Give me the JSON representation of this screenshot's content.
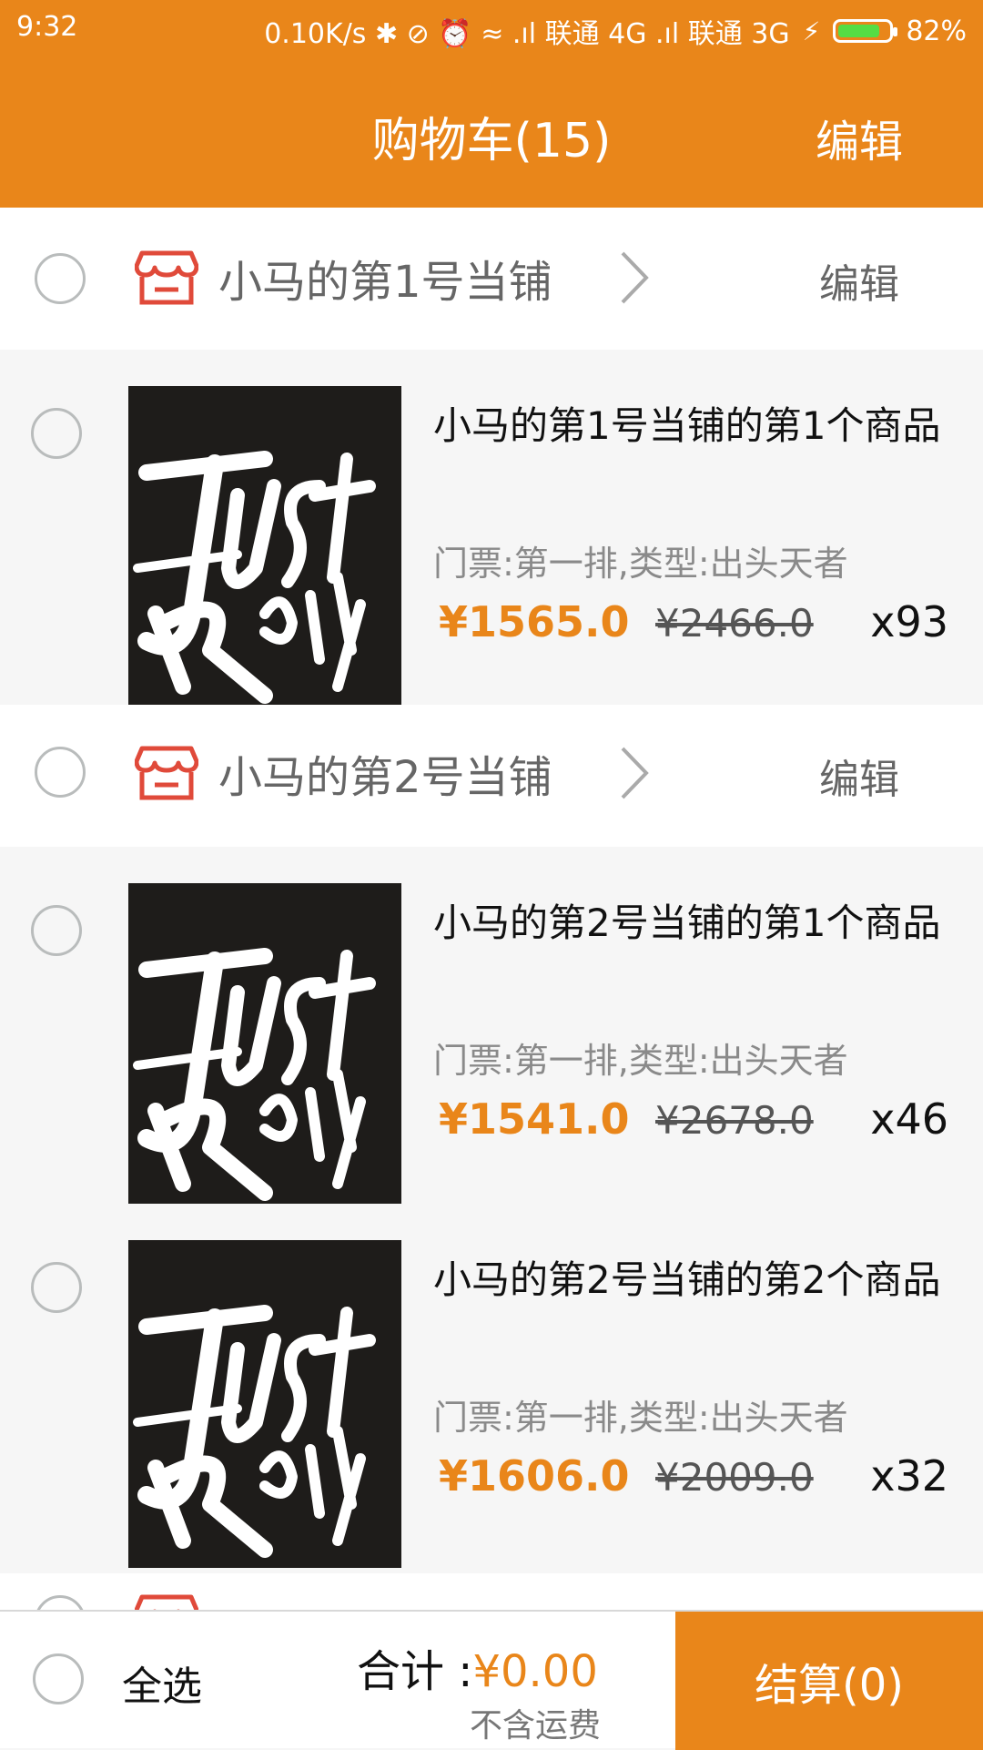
{
  "status": {
    "time": "9:32",
    "right": "0.10K/s ✱ ⊘ ⏰ ≈ .ıl 联通 4G .ıl 联通 3G",
    "battery": "82%",
    "battery_level": 0.82
  },
  "header": {
    "title": "购物车(15)",
    "edit": "编辑"
  },
  "shops": [
    {
      "name": "小马的第1号当铺",
      "edit": "编辑",
      "items": [
        {
          "title": "小马的第1号当铺的第1个商品",
          "spec": "门票:第一排,类型:出头天者",
          "price": "¥1565.0",
          "orig_price": "¥2466.0",
          "qty": "x93"
        }
      ]
    },
    {
      "name": "小马的第2号当铺",
      "edit": "编辑",
      "items": [
        {
          "title": "小马的第2号当铺的第1个商品",
          "spec": "门票:第一排,类型:出头天者",
          "price": "¥1541.0",
          "orig_price": "¥2678.0",
          "qty": "x46"
        },
        {
          "title": "小马的第2号当铺的第2个商品",
          "spec": "门票:第一排,类型:出头天者",
          "price": "¥1606.0",
          "orig_price": "¥2009.0",
          "qty": "x32"
        }
      ]
    }
  ],
  "footer": {
    "select_all": "全选",
    "total_label": "合计 :",
    "total_amount": "¥0.00",
    "freight_note": "不含运费",
    "checkout": "结算(0)"
  },
  "product_image_text": "JUST ROCK IT",
  "colors": {
    "accent": "#e9861a",
    "shop_icon": "#e04a3a"
  }
}
